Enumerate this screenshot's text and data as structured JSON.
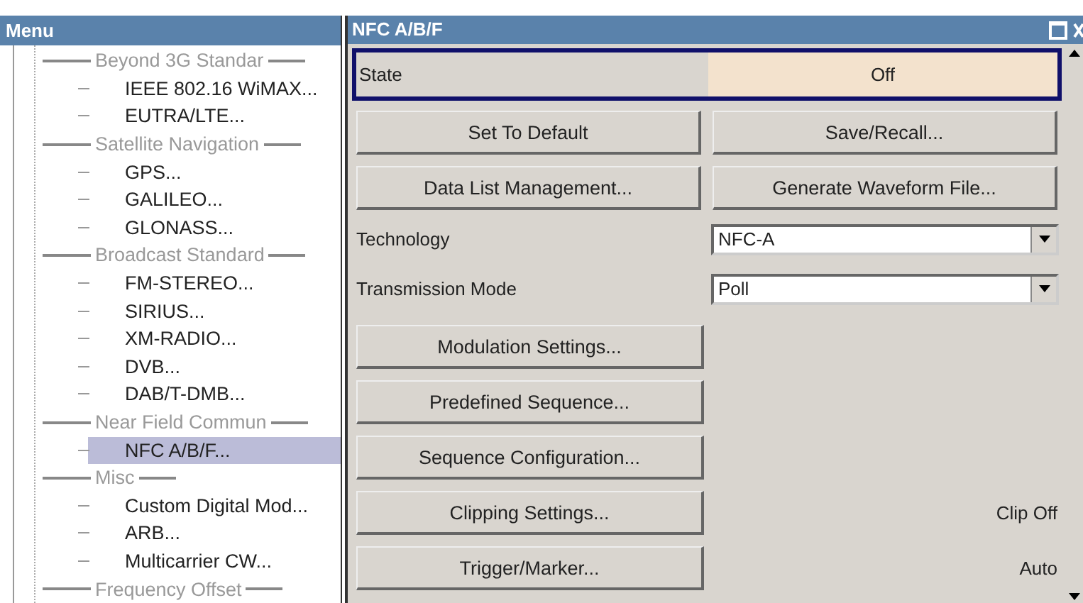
{
  "menu": {
    "title": "Menu",
    "items": [
      {
        "kind": "header",
        "label": "Beyond 3G Standar"
      },
      {
        "kind": "item",
        "label": "IEEE 802.16 WiMAX...",
        "selected": false
      },
      {
        "kind": "item",
        "label": "EUTRA/LTE...",
        "selected": false
      },
      {
        "kind": "header",
        "label": "Satellite Navigation"
      },
      {
        "kind": "item",
        "label": "GPS...",
        "selected": false
      },
      {
        "kind": "item",
        "label": "GALILEO...",
        "selected": false
      },
      {
        "kind": "item",
        "label": "GLONASS...",
        "selected": false
      },
      {
        "kind": "header",
        "label": "Broadcast Standard"
      },
      {
        "kind": "item",
        "label": "FM-STEREO...",
        "selected": false
      },
      {
        "kind": "item",
        "label": "SIRIUS...",
        "selected": false
      },
      {
        "kind": "item",
        "label": "XM-RADIO...",
        "selected": false
      },
      {
        "kind": "item",
        "label": "DVB...",
        "selected": false
      },
      {
        "kind": "item",
        "label": "DAB/T-DMB...",
        "selected": false
      },
      {
        "kind": "header",
        "label": "Near Field Commun"
      },
      {
        "kind": "item",
        "label": "NFC A/B/F...",
        "selected": true
      },
      {
        "kind": "header",
        "label": "Misc"
      },
      {
        "kind": "item",
        "label": "Custom Digital Mod...",
        "selected": false
      },
      {
        "kind": "item",
        "label": "ARB...",
        "selected": false
      },
      {
        "kind": "item",
        "label": "Multicarrier CW...",
        "selected": false
      },
      {
        "kind": "header",
        "label": "Frequency Offset"
      }
    ]
  },
  "dialog": {
    "title": "NFC A/B/F",
    "state": {
      "label": "State",
      "value": "Off"
    },
    "top_buttons": [
      "Set To Default",
      "Save/Recall...",
      "Data List Management...",
      "Generate Waveform File..."
    ],
    "fields": [
      {
        "label": "Technology",
        "value": "NFC-A"
      },
      {
        "label": "Transmission Mode",
        "value": "Poll"
      }
    ],
    "buttons": [
      {
        "label": "Modulation Settings..."
      },
      {
        "label": "Predefined Sequence..."
      },
      {
        "label": "Sequence Configuration..."
      },
      {
        "label": "Clipping Settings...",
        "status": "Clip Off"
      },
      {
        "label": "Trigger/Marker...",
        "status": "Auto"
      }
    ]
  }
}
